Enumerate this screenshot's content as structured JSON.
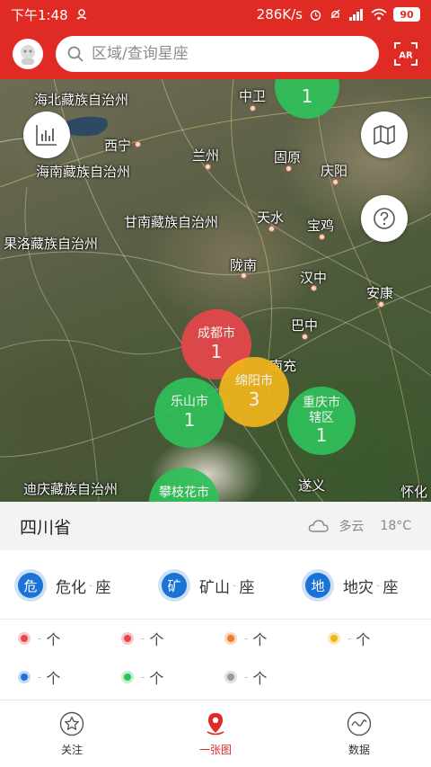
{
  "status_bar": {
    "time": "下午1:48",
    "speed": "286K/s",
    "battery": "90"
  },
  "header": {
    "search_placeholder": "区域/查询星座",
    "ar_label": "AR"
  },
  "map": {
    "places": [
      "海北藏族自治州",
      "中卫",
      "西宁",
      "兰州",
      "海南藏族自治州",
      "固原",
      "庆阳",
      "甘南藏族自治州",
      "天水",
      "宝鸡",
      "果洛藏族自治州",
      "陇南",
      "汉中",
      "安康",
      "巴中",
      "南充",
      "迪庆藏族自治州",
      "遂义",
      "怀化"
    ],
    "clusters": [
      {
        "name": "成都市",
        "count": "1",
        "color": "#e8474c"
      },
      {
        "name": "绵阳市",
        "count": "3",
        "color": "#f2b51c"
      },
      {
        "name": "乐山市",
        "count": "1",
        "color": "#2fc15a"
      },
      {
        "name": "重庆市辖区",
        "count": "1",
        "color": "#2fc15a"
      },
      {
        "name": "攀枝花市",
        "count": "",
        "color": "#2fc15a"
      },
      {
        "name": "",
        "count": "1",
        "color": "#2fc15a"
      }
    ]
  },
  "info": {
    "province": "四川省",
    "weather": "多云",
    "temperature": "18°C"
  },
  "categories": [
    {
      "badge": "危",
      "label": "危化",
      "dash": "-",
      "unit": "座"
    },
    {
      "badge": "矿",
      "label": "矿山",
      "dash": "-",
      "unit": "座"
    },
    {
      "badge": "地",
      "label": "地灾",
      "dash": "-",
      "unit": "座"
    }
  ],
  "legend": [
    {
      "dash": "-",
      "unit": "个",
      "color": "#e8474c"
    },
    {
      "dash": "-",
      "unit": "个",
      "color": "#e8474c"
    },
    {
      "dash": "-",
      "unit": "个",
      "color": "#f07a2e"
    },
    {
      "dash": "-",
      "unit": "个",
      "color": "#f2b51c"
    },
    {
      "dash": "-",
      "unit": "个",
      "color": "#1a73d6"
    },
    {
      "dash": "-",
      "unit": "个",
      "color": "#2fc15a"
    },
    {
      "dash": "-",
      "unit": "个",
      "color": "#9a9a9a"
    }
  ],
  "nav": [
    {
      "label": "关注",
      "icon": "star-icon"
    },
    {
      "label": "一张图",
      "icon": "map-pin-icon"
    },
    {
      "label": "数据",
      "icon": "chart-wave-icon"
    }
  ],
  "colors": {
    "brand": "#e02a24"
  }
}
